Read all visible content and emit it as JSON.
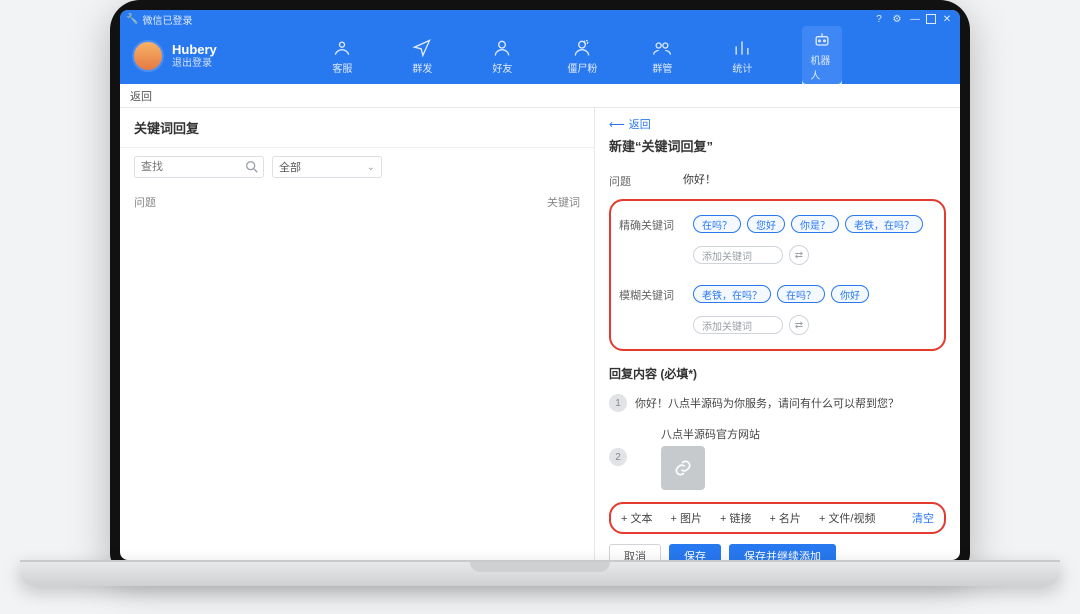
{
  "titlebar": {
    "app_status": "微信已登录"
  },
  "user": {
    "name": "Hubery",
    "sub": "退出登录"
  },
  "nav": [
    {
      "key": "cs",
      "label": "客服"
    },
    {
      "key": "mass",
      "label": "群发"
    },
    {
      "key": "friends",
      "label": "好友"
    },
    {
      "key": "zombie",
      "label": "僵尸粉"
    },
    {
      "key": "group",
      "label": "群管"
    },
    {
      "key": "stats",
      "label": "统计"
    },
    {
      "key": "robot",
      "label": "机器人"
    }
  ],
  "strip": {
    "back": "返回"
  },
  "left": {
    "title": "关键词回复",
    "search_placeholder": "查找",
    "filter_all": "全部",
    "col_question": "问题",
    "col_keyword": "关键词"
  },
  "right": {
    "back": "返回",
    "title": "新建“关键词回复”",
    "question_label": "问题",
    "question_value": "你好！",
    "exact_label": "精确关键词",
    "exact_tags": [
      "在吗？",
      "您好",
      "你是？",
      "老铁，在吗？"
    ],
    "fuzzy_label": "模糊关键词",
    "fuzzy_tags": [
      "老铁，在吗？",
      "在吗？",
      "你好"
    ],
    "add_keyword_placeholder": "添加关键词",
    "reply_header": "回复内容 (必填*)",
    "reply_text_1": "你好！八点半源码为你服务，请问有什么可以帮到您？",
    "reply_link_title": "八点半源码官方网站",
    "tools": {
      "text": "+ 文本",
      "image": "+ 图片",
      "link": "+ 链接",
      "card": "+ 名片",
      "file": "+ 文件/视频",
      "clear": "清空"
    },
    "actions": {
      "cancel": "取消",
      "save": "保存",
      "save_continue": "保存并继续添加"
    }
  }
}
